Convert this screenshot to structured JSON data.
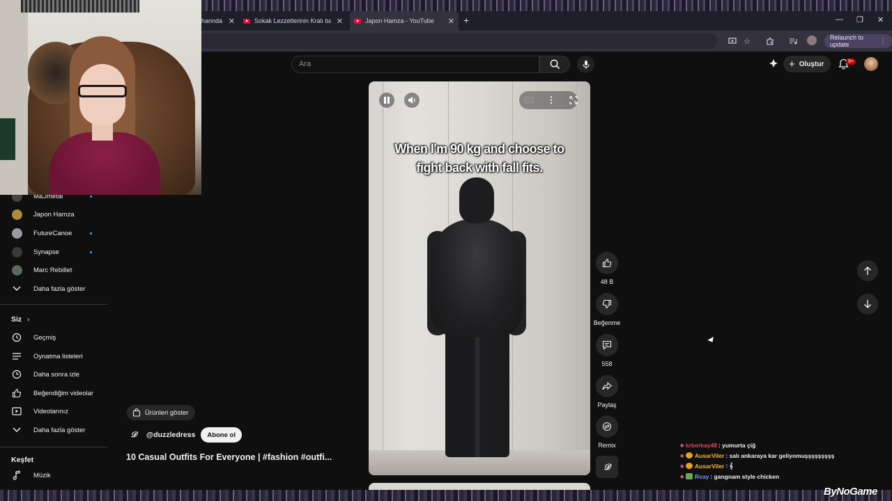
{
  "browser": {
    "tabs": [
      {
        "label": "hannda"
      },
      {
        "label": "Sokak Lezzetlerinin Kralı bahar"
      },
      {
        "label": "Japon Hamza - YouTube"
      }
    ],
    "relaunch_label": "Relaunch to update"
  },
  "header": {
    "search_placeholder": "Ara",
    "create_label": "Oluştur",
    "notification_count": "9+"
  },
  "sidebar": {
    "subscriptions": [
      {
        "label": "M&Jmetal",
        "color": "#444444",
        "new": true
      },
      {
        "label": "Japon Hamza",
        "color": "#b08a3a",
        "new": false
      },
      {
        "label": "FutureCanoe",
        "color": "#9a9aa0",
        "new": true
      },
      {
        "label": "Synapse",
        "color": "#3a3a3a",
        "new": true
      },
      {
        "label": "Marc Rebillet",
        "color": "#5a6a5a",
        "new": false
      }
    ],
    "show_more_1": "Daha fazla göster",
    "you_heading": "Siz",
    "you_items": [
      {
        "label": "Geçmiş",
        "icon": "history-icon"
      },
      {
        "label": "Oynatma listeleri",
        "icon": "playlist-icon"
      },
      {
        "label": "Daha sonra izle",
        "icon": "clock-icon"
      },
      {
        "label": "Beğendiğim videolar",
        "icon": "thumbs-up-icon"
      },
      {
        "label": "Videolarınız",
        "icon": "video-icon"
      }
    ],
    "show_more_2": "Daha fazla göster",
    "explore_heading": "Keşfet",
    "explore_items": [
      {
        "label": "Müzik",
        "icon": "music-note-icon"
      }
    ]
  },
  "video": {
    "caption_line1": "When I'm 90 kg and choose to",
    "caption_line2": "fight back with fall fits."
  },
  "actions": {
    "likes": "48 B",
    "dislike_label": "Beğenme",
    "comments": "558",
    "share_label": "Paylaş",
    "remix_label": "Remix"
  },
  "short": {
    "products_label": "Ürünleri göster",
    "channel_handle": "@duzzledress",
    "subscribe_label": "Abone ol",
    "title": "10 Casual Outfits For Everyone | #fashion #outfi..."
  },
  "chat": [
    {
      "user": "krberkay48",
      "user_color": "#e0455a",
      "msg": ": yumurta çiğ",
      "badge": "none"
    },
    {
      "user": "AusarViler",
      "user_color": "#f0b93a",
      "msg": ": salı ankaraya kar geliyomuşşşşşşşşş",
      "badge": "circle"
    },
    {
      "user": "AusarViler",
      "user_color": "#f0b93a",
      "msg": ": 𝄞",
      "badge": "circle"
    },
    {
      "user": "Rvay",
      "user_color": "#7a8cff",
      "msg": ": gangnam style chicken",
      "badge": "square"
    }
  ],
  "watermark": "ByNoGame"
}
